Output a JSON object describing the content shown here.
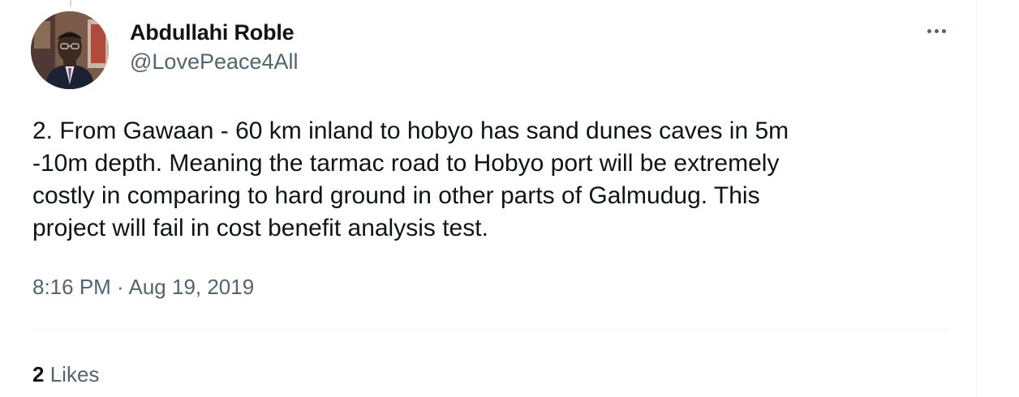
{
  "tweet": {
    "author": {
      "display_name": "Abdullahi Roble",
      "handle": "@LovePeace4All"
    },
    "text": "2. From Gawaan - 60 km inland to hobyo has sand dunes caves in 5m\n-10m depth. Meaning the tarmac road to Hobyo port will be extremely\ncostly in comparing to hard ground in other parts of Galmudug. This\nproject will fail in cost benefit analysis test.",
    "timestamp": "8:16 PM · Aug 19, 2019",
    "likes": {
      "count": "2",
      "label": "Likes"
    }
  },
  "icons": {
    "more": "more-horizontal-icon"
  },
  "colors": {
    "text_primary": "#0f1419",
    "text_secondary": "#536471",
    "divider": "#eff3f4"
  }
}
